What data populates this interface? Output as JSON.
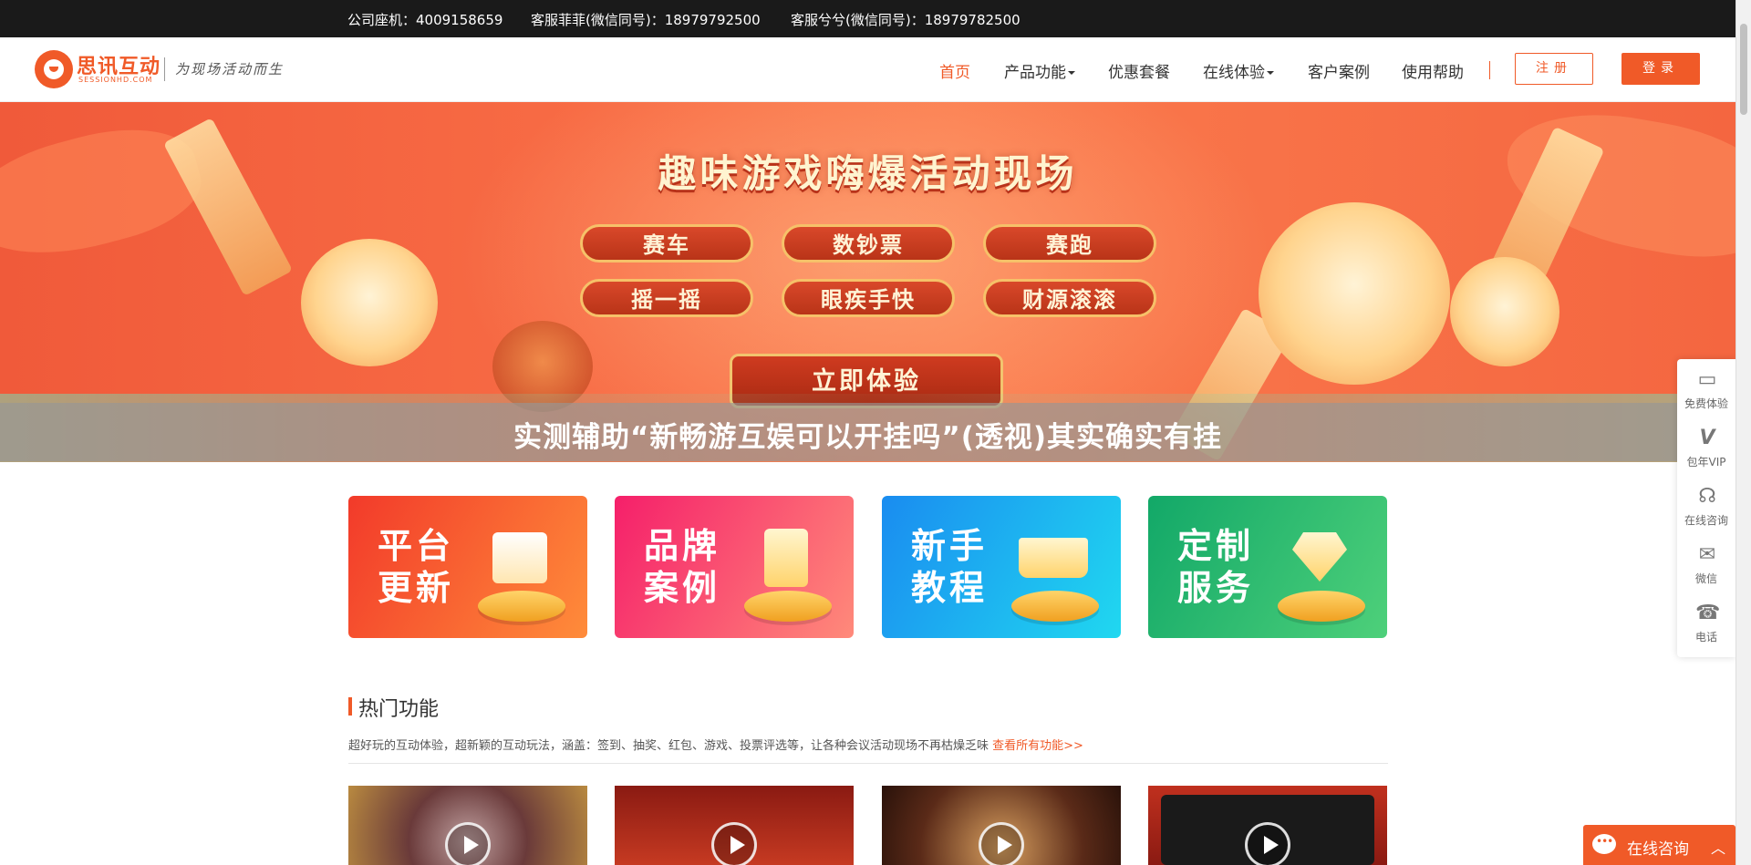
{
  "topbar": {
    "phone": "公司座机：4009158659",
    "service1": "客服菲菲(微信同号)：18979792500",
    "service2": "客服兮兮(微信同号)：18979782500"
  },
  "header": {
    "logo_name": "思讯互动",
    "logo_domain": "SESSIONHD.COM",
    "slogan": "为现场活动而生",
    "nav": [
      {
        "label": "首页",
        "active": true
      },
      {
        "label": "产品功能",
        "dropdown": true
      },
      {
        "label": "优惠套餐"
      },
      {
        "label": "在线体验",
        "dropdown": true
      },
      {
        "label": "客户案例"
      },
      {
        "label": "使用帮助"
      }
    ],
    "register_label": "注册",
    "login_label": "登录"
  },
  "banner": {
    "title": "趣味游戏嗨爆活动现场",
    "games": [
      "赛车",
      "数钞票",
      "赛跑",
      "摇一摇",
      "眼疾手快",
      "财源滚滚"
    ],
    "cta": "立即体验",
    "overlay_title": "实测辅助“新畅游互娱可以开挂吗”(透视)其实确实有挂"
  },
  "cards": [
    {
      "line1": "平台",
      "line2": "更新",
      "color": "#f04a2e"
    },
    {
      "line1": "品牌",
      "line2": "案例",
      "color": "#f5377a"
    },
    {
      "line1": "新手",
      "line2": "教程",
      "color": "#1eaaf0"
    },
    {
      "line1": "定制",
      "line2": "服务",
      "color": "#22b86a"
    }
  ],
  "hot": {
    "title": "热门功能",
    "desc": "超好玩的互动体验，超新颖的互动玩法，涵盖：签到、抽奖、红包、游戏、投票评选等，让各种会议活动现场不再枯燥乏味",
    "link": "查看所有功能>>"
  },
  "sidebar": [
    {
      "label": "免费体验",
      "icon": "monitor-icon"
    },
    {
      "label": "包年VIP",
      "icon": "vip-icon"
    },
    {
      "label": "在线咨询",
      "icon": "headset-icon"
    },
    {
      "label": "微信",
      "icon": "wechat-icon"
    },
    {
      "label": "电话",
      "icon": "phone-icon"
    }
  ],
  "chat": {
    "label": "在线咨询",
    "icon": "chat-bubble-icon"
  },
  "colors": {
    "brand": "#f05a28",
    "topbar": "#1a1a1a"
  }
}
